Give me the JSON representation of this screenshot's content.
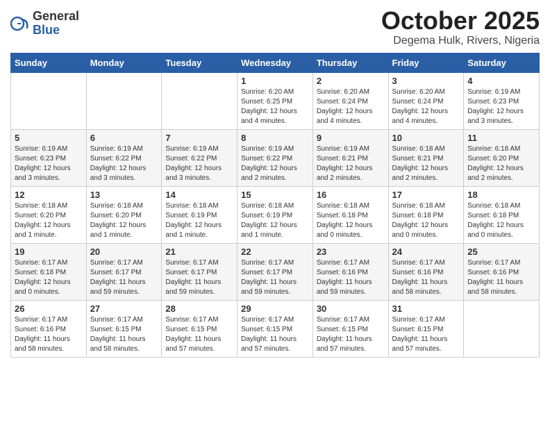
{
  "logo": {
    "general": "General",
    "blue": "Blue"
  },
  "title": "October 2025",
  "location": "Degema Hulk, Rivers, Nigeria",
  "weekdays": [
    "Sunday",
    "Monday",
    "Tuesday",
    "Wednesday",
    "Thursday",
    "Friday",
    "Saturday"
  ],
  "weeks": [
    [
      {
        "day": "",
        "info": ""
      },
      {
        "day": "",
        "info": ""
      },
      {
        "day": "",
        "info": ""
      },
      {
        "day": "1",
        "info": "Sunrise: 6:20 AM\nSunset: 6:25 PM\nDaylight: 12 hours and 4 minutes."
      },
      {
        "day": "2",
        "info": "Sunrise: 6:20 AM\nSunset: 6:24 PM\nDaylight: 12 hours and 4 minutes."
      },
      {
        "day": "3",
        "info": "Sunrise: 6:20 AM\nSunset: 6:24 PM\nDaylight: 12 hours and 4 minutes."
      },
      {
        "day": "4",
        "info": "Sunrise: 6:19 AM\nSunset: 6:23 PM\nDaylight: 12 hours and 3 minutes."
      }
    ],
    [
      {
        "day": "5",
        "info": "Sunrise: 6:19 AM\nSunset: 6:23 PM\nDaylight: 12 hours and 3 minutes."
      },
      {
        "day": "6",
        "info": "Sunrise: 6:19 AM\nSunset: 6:22 PM\nDaylight: 12 hours and 3 minutes."
      },
      {
        "day": "7",
        "info": "Sunrise: 6:19 AM\nSunset: 6:22 PM\nDaylight: 12 hours and 3 minutes."
      },
      {
        "day": "8",
        "info": "Sunrise: 6:19 AM\nSunset: 6:22 PM\nDaylight: 12 hours and 2 minutes."
      },
      {
        "day": "9",
        "info": "Sunrise: 6:19 AM\nSunset: 6:21 PM\nDaylight: 12 hours and 2 minutes."
      },
      {
        "day": "10",
        "info": "Sunrise: 6:18 AM\nSunset: 6:21 PM\nDaylight: 12 hours and 2 minutes."
      },
      {
        "day": "11",
        "info": "Sunrise: 6:18 AM\nSunset: 6:20 PM\nDaylight: 12 hours and 2 minutes."
      }
    ],
    [
      {
        "day": "12",
        "info": "Sunrise: 6:18 AM\nSunset: 6:20 PM\nDaylight: 12 hours and 1 minute."
      },
      {
        "day": "13",
        "info": "Sunrise: 6:18 AM\nSunset: 6:20 PM\nDaylight: 12 hours and 1 minute."
      },
      {
        "day": "14",
        "info": "Sunrise: 6:18 AM\nSunset: 6:19 PM\nDaylight: 12 hours and 1 minute."
      },
      {
        "day": "15",
        "info": "Sunrise: 6:18 AM\nSunset: 6:19 PM\nDaylight: 12 hours and 1 minute."
      },
      {
        "day": "16",
        "info": "Sunrise: 6:18 AM\nSunset: 6:18 PM\nDaylight: 12 hours and 0 minutes."
      },
      {
        "day": "17",
        "info": "Sunrise: 6:18 AM\nSunset: 6:18 PM\nDaylight: 12 hours and 0 minutes."
      },
      {
        "day": "18",
        "info": "Sunrise: 6:18 AM\nSunset: 6:18 PM\nDaylight: 12 hours and 0 minutes."
      }
    ],
    [
      {
        "day": "19",
        "info": "Sunrise: 6:17 AM\nSunset: 6:18 PM\nDaylight: 12 hours and 0 minutes."
      },
      {
        "day": "20",
        "info": "Sunrise: 6:17 AM\nSunset: 6:17 PM\nDaylight: 11 hours and 59 minutes."
      },
      {
        "day": "21",
        "info": "Sunrise: 6:17 AM\nSunset: 6:17 PM\nDaylight: 11 hours and 59 minutes."
      },
      {
        "day": "22",
        "info": "Sunrise: 6:17 AM\nSunset: 6:17 PM\nDaylight: 11 hours and 59 minutes."
      },
      {
        "day": "23",
        "info": "Sunrise: 6:17 AM\nSunset: 6:16 PM\nDaylight: 11 hours and 59 minutes."
      },
      {
        "day": "24",
        "info": "Sunrise: 6:17 AM\nSunset: 6:16 PM\nDaylight: 11 hours and 58 minutes."
      },
      {
        "day": "25",
        "info": "Sunrise: 6:17 AM\nSunset: 6:16 PM\nDaylight: 11 hours and 58 minutes."
      }
    ],
    [
      {
        "day": "26",
        "info": "Sunrise: 6:17 AM\nSunset: 6:16 PM\nDaylight: 11 hours and 58 minutes."
      },
      {
        "day": "27",
        "info": "Sunrise: 6:17 AM\nSunset: 6:15 PM\nDaylight: 11 hours and 58 minutes."
      },
      {
        "day": "28",
        "info": "Sunrise: 6:17 AM\nSunset: 6:15 PM\nDaylight: 11 hours and 57 minutes."
      },
      {
        "day": "29",
        "info": "Sunrise: 6:17 AM\nSunset: 6:15 PM\nDaylight: 11 hours and 57 minutes."
      },
      {
        "day": "30",
        "info": "Sunrise: 6:17 AM\nSunset: 6:15 PM\nDaylight: 11 hours and 57 minutes."
      },
      {
        "day": "31",
        "info": "Sunrise: 6:17 AM\nSunset: 6:15 PM\nDaylight: 11 hours and 57 minutes."
      },
      {
        "day": "",
        "info": ""
      }
    ]
  ]
}
